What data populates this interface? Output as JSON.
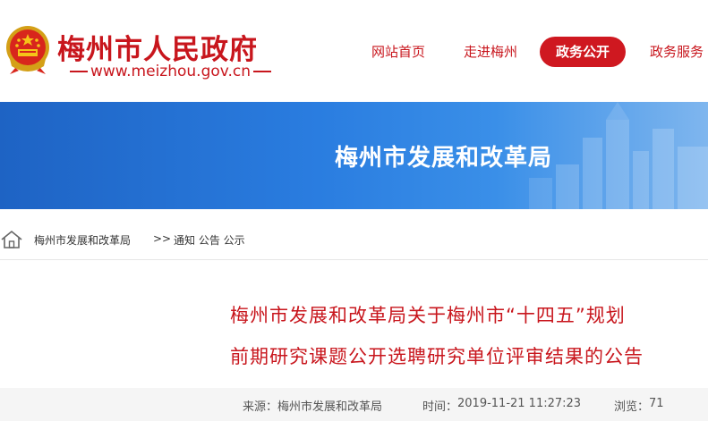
{
  "header": {
    "site_title": "梅州市人民政府",
    "site_url": "www.meizhou.gov.cn",
    "nav": [
      {
        "label": "网站首页"
      },
      {
        "label": "走进梅州"
      },
      {
        "label": "政务公开",
        "active": true
      },
      {
        "label": "政务服务"
      }
    ]
  },
  "banner": {
    "title": "梅州市发展和改革局"
  },
  "breadcrumb": {
    "items": [
      "梅州市发展和改革局",
      ">>",
      "通知 公告 公示"
    ]
  },
  "article": {
    "title_line1": "梅州市发展和改革局关于梅州市“十四五”规划",
    "title_line2": "前期研究课题公开选聘研究单位评审结果的公告",
    "source_label": "来源：",
    "source_value": "梅州市发展和改革局",
    "time_label": "时间：",
    "time_value": "2019-11-21 11:27:23",
    "views_label": "浏览：",
    "views_value": "71"
  },
  "colors": {
    "brand_red": "#c8161d",
    "banner_blue": "#2a7de0",
    "meta_bg": "#f5f5f5"
  },
  "icons": [
    "national-emblem-icon",
    "home-icon"
  ]
}
